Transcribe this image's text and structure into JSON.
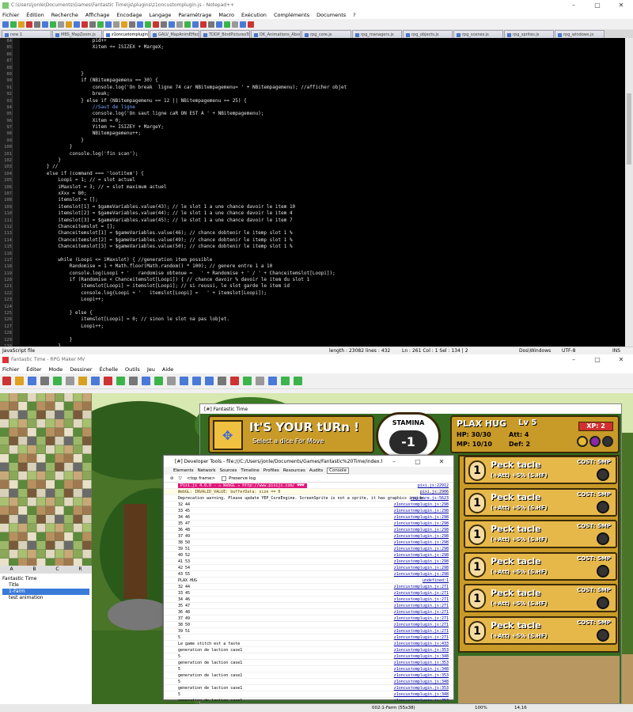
{
  "npp": {
    "title": "C:\\Users\\jonle\\Documents\\Games\\Fantastic Time\\js\\plugins\\z1oncustomplugin.js - Notepad++",
    "menu": [
      "Fichier",
      "Édition",
      "Recherche",
      "Affichage",
      "Encodage",
      "Langage",
      "Paramétrage",
      "Macro",
      "Exécution",
      "Compléments",
      "Documents",
      "?"
    ],
    "tabs": [
      "new 1",
      "MBS_MapZoom.js",
      "z1oncustomplugin.js",
      "GALV_MapAnimEffects.js",
      "TDDP_BindPicturesToMap.js",
      "DK_Animations_Above_Pictures.js",
      "rpg_core.js",
      "rpg_managers.js",
      "rpg_objects.js",
      "rpg_scenes.js",
      "rpg_sprites.js",
      "rpg_windows.js"
    ],
    "active_tab": "z1oncustomplugin.js",
    "lines": [
      {
        "n": "84",
        "t": "                        pid++"
      },
      {
        "n": "85",
        "t": "                        Xitem += ISIZEX + MargeX;"
      },
      {
        "n": "86",
        "t": ""
      },
      {
        "n": "87",
        "t": ""
      },
      {
        "n": "88",
        "t": ""
      },
      {
        "n": "89",
        "t": "                    }"
      },
      {
        "n": "90",
        "t": "                    if (NBitempagemenu == 30) {"
      },
      {
        "n": "91",
        "t": "                        console.log('On break  ligne 74 car NBitempagemenu= ' + NBitempagemenu); //afficher objet"
      },
      {
        "n": "92",
        "t": "                        break;"
      },
      {
        "n": "93",
        "t": "                    } else if (NBitempagemenu == 12 || NBitempagemenu == 25) {"
      },
      {
        "n": "94",
        "t": "                        //Saut de ligne"
      },
      {
        "n": "95",
        "t": "                        console.log('On saut ligne caR ON EST A ' + NBitempagemenu);"
      },
      {
        "n": "96",
        "t": "                        Xitem = 0;"
      },
      {
        "n": "97",
        "t": "                        Yitem += ISIZEY + MargeY;"
      },
      {
        "n": "98",
        "t": "                        NBitempagemenu++;"
      },
      {
        "n": "99",
        "t": "                    }"
      },
      {
        "n": "100",
        "t": "                }"
      },
      {
        "n": "101",
        "t": "                console.log('fin scan');"
      },
      {
        "n": "102",
        "t": "            }"
      },
      {
        "n": "103",
        "t": "        } //"
      },
      {
        "n": "104",
        "t": "        else if (command === 'lootitem') {"
      },
      {
        "n": "105",
        "t": "            Loopi = 1; // = slot actuel"
      },
      {
        "n": "106",
        "t": "            iMaxslot = 3; // = slot maximum actuel"
      },
      {
        "n": "107",
        "t": "            xXxx = 80;"
      },
      {
        "n": "108",
        "t": "            itemslot = [];"
      },
      {
        "n": "109",
        "t": "            itemslot[1] = $gameVariables.value(43); // le slot 1 a une chance davoir le item 10"
      },
      {
        "n": "110",
        "t": "            itemslot[2] = $gameVariables.value(44); // le slot 1 a une chance davoir le item 4"
      },
      {
        "n": "111",
        "t": "            itemslot[3] = $gameVariables.value(45); // le slot 1 a une chance davoir le item 7"
      },
      {
        "n": "112",
        "t": "            Chanceitemslot = [];"
      },
      {
        "n": "113",
        "t": "            Chanceitemslot[1] = $gameVariables.value(46); // chance dobtenir le itemp slot 1 %"
      },
      {
        "n": "114",
        "t": "            Chanceitemslot[2] = $gameVariables.value(49); // chance dobtenir le itemp slot 1 %"
      },
      {
        "n": "115",
        "t": "            Chanceitemslot[3] = $gameVariables.value(50); // chance dobtenir le itemp slot 1 %"
      },
      {
        "n": "116",
        "t": ""
      },
      {
        "n": "117",
        "t": "            while (Loopi <= iMaxslot) { //generation item possible"
      },
      {
        "n": "118",
        "t": "                Randomise = 1 + Math.floor(Math.random() * 100); // genere entre 1 a 10"
      },
      {
        "n": "119",
        "t": "                console.log(Loopi + '   randomise obtenue =   ' + Randomise + ' / ' + Chanceitemslot[Loopi]);"
      },
      {
        "n": "120",
        "t": "                if (Randomise < Chanceitemslot[Loopi]) { // chance davoir % davoir le item du slot 1"
      },
      {
        "n": "121",
        "t": "                    itemslot[Loopi] = itemslot[Loopi]; // si reussi, le slot garde le item id"
      },
      {
        "n": "122",
        "t": "                    console.log(Loopi + '   itemslot[Loopi] =   ' + itemslot[Loopi]);"
      },
      {
        "n": "123",
        "t": "                    Loopi++;"
      },
      {
        "n": "124",
        "t": ""
      },
      {
        "n": "125",
        "t": "                } else {"
      },
      {
        "n": "126",
        "t": "                    itemslot[Loopi] = 0; // sinon le slot na pas lobjet."
      },
      {
        "n": "127",
        "t": "                    Loopi++;"
      },
      {
        "n": "128",
        "t": ""
      },
      {
        "n": "129",
        "t": "                }"
      },
      {
        "n": "130",
        "t": "            }"
      }
    ],
    "status": {
      "lang": "JavaScript file",
      "length": "length : 23082    lines : 432",
      "pos": "Ln : 261    Col : 1    Sel : 134 | 2",
      "eol": "Dos\\Windows",
      "enc": "UTF-8",
      "mode": "INS"
    }
  },
  "rm": {
    "title": "Fantastic Time - RPG Maker MV",
    "menu": [
      "Fichier",
      "Éditer",
      "Mode",
      "Dessiner",
      "Échelle",
      "Outils",
      "Jeu",
      "Aide"
    ],
    "tile_tabs": [
      "A",
      "B",
      "C",
      "R"
    ],
    "tree": [
      "Fantastic Time",
      "Title",
      "1-Farm",
      "test animation"
    ],
    "status": {
      "map": "002:1-Farm (55x38)",
      "zoom": "100%",
      "coord": "14,16"
    }
  },
  "game": {
    "title": "[#] Fantastic Time",
    "banner": "It'S YOUR tURn !",
    "sub": "Select a dice For Move",
    "stamina_label": "STAMINA",
    "stamina_value": "-1",
    "player": {
      "name": "PLAX HUG",
      "lv": "Lv 5",
      "xp": "XP: 2",
      "hp": "HP: 30/30",
      "att": "Att: 4",
      "mp": "MP: 10/10",
      "def": "Def: 2"
    },
    "cards": [
      {
        "lv": "1",
        "name": "Peck tacle",
        "eff": "(+Att) +5% (S.HF)",
        "cost": "COST: 5MP"
      },
      {
        "lv": "1",
        "name": "Peck tacle",
        "eff": "(+Att) +5% (S.HF)",
        "cost": "COST: 5MP"
      },
      {
        "lv": "1",
        "name": "Peck tacle",
        "eff": "(+Att) +5% (S.HF)",
        "cost": "COST: 5MP"
      },
      {
        "lv": "1",
        "name": "Peck tacle",
        "eff": "(+Att) +5% (S.HF)",
        "cost": "COST: 5MP"
      },
      {
        "lv": "1",
        "name": "Peck tacle",
        "eff": "(+Att) +5% (S.HF)",
        "cost": "COST: 5MP"
      },
      {
        "lv": "1",
        "name": "Peck tacle",
        "eff": "(+Att) +5% (S.HF)",
        "cost": "COST: 5MP"
      }
    ]
  },
  "dev": {
    "title": "[#] Developer Tools - file:///C:/Users/jonle/Documents/Games/Fantastic%20Time/index.html?test [#]",
    "tabs": [
      "Elements",
      "Network",
      "Sources",
      "Timeline",
      "Profiles",
      "Resources",
      "Audits",
      "Console"
    ],
    "filter": "<top frame>",
    "preserve": "Preserve log",
    "logs": [
      {
        "t": "Pixi.js 4.0.0 - ✰ WebGL ✰   http://www.pixijs.com/  ♥♥♥",
        "s": "pixi.js:22912"
      },
      {
        "t": "WebGL: INVALID_VALUE: bufferData: size == 0",
        "s": "pixi.js:2906"
      },
      {
        "t": "Deprecation warning. Please update YEP_CoreEngine. ScreenSprite is not a sprite, it has graphics inside.",
        "s": "rpg_core.js:5623"
      },
      {
        "t": "32 44",
        "s": "z1oncustomplugin.js:298"
      },
      {
        "t": "33 45",
        "s": "z1oncustomplugin.js:298"
      },
      {
        "t": "34 46",
        "s": "z1oncustomplugin.js:298"
      },
      {
        "t": "35 47",
        "s": "z1oncustomplugin.js:298"
      },
      {
        "t": "36 48",
        "s": "z1oncustomplugin.js:298"
      },
      {
        "t": "37 49",
        "s": "z1oncustomplugin.js:298"
      },
      {
        "t": "38 50",
        "s": "z1oncustomplugin.js:298"
      },
      {
        "t": "39 51",
        "s": "z1oncustomplugin.js:298"
      },
      {
        "t": "40 52",
        "s": "z1oncustomplugin.js:298"
      },
      {
        "t": "41 53",
        "s": "z1oncustomplugin.js:298"
      },
      {
        "t": "42 54",
        "s": "z1oncustomplugin.js:298"
      },
      {
        "t": "43 55",
        "s": "z1oncustomplugin.js:298"
      },
      {
        "t": "PLAX HUG",
        "s": "undefined:1"
      },
      {
        "t": "32 44",
        "s": "z1oncustomplugin.js:271"
      },
      {
        "t": "33 45",
        "s": "z1oncustomplugin.js:271"
      },
      {
        "t": "34 46",
        "s": "z1oncustomplugin.js:271"
      },
      {
        "t": "35 47",
        "s": "z1oncustomplugin.js:271"
      },
      {
        "t": "36 48",
        "s": "z1oncustomplugin.js:271"
      },
      {
        "t": "37 49",
        "s": "z1oncustomplugin.js:271"
      },
      {
        "t": "38 50",
        "s": "z1oncustomplugin.js:271"
      },
      {
        "t": "39 51",
        "s": "z1oncustomplugin.js:271"
      },
      {
        "t": "5",
        "s": "z1oncustomplugin.js:271"
      },
      {
        "t": "Le game stitch est a faste",
        "s": "z1oncustomplugin.js:433"
      },
      {
        "t": "generation de laction case1",
        "s": "z1oncustomplugin.js:353"
      },
      {
        "t": "5",
        "s": "z1oncustomplugin.js:348"
      },
      {
        "t": "generation de laction case1",
        "s": "z1oncustomplugin.js:353"
      },
      {
        "t": "5",
        "s": "z1oncustomplugin.js:348"
      },
      {
        "t": "generation de laction case1",
        "s": "z1oncustomplugin.js:353"
      },
      {
        "t": "5",
        "s": "z1oncustomplugin.js:348"
      },
      {
        "t": "generation de laction case1",
        "s": "z1oncustomplugin.js:353"
      },
      {
        "t": "5",
        "s": "z1oncustomplugin.js:348"
      },
      {
        "t": "generation de laction case1",
        "s": "z1oncustomplugin.js:353"
      },
      {
        "t": "5",
        "s": "z1oncustomplugin.js:348"
      },
      {
        "t": "generation de laction case1",
        "s": "z1oncustomplugin.js:348"
      }
    ]
  }
}
